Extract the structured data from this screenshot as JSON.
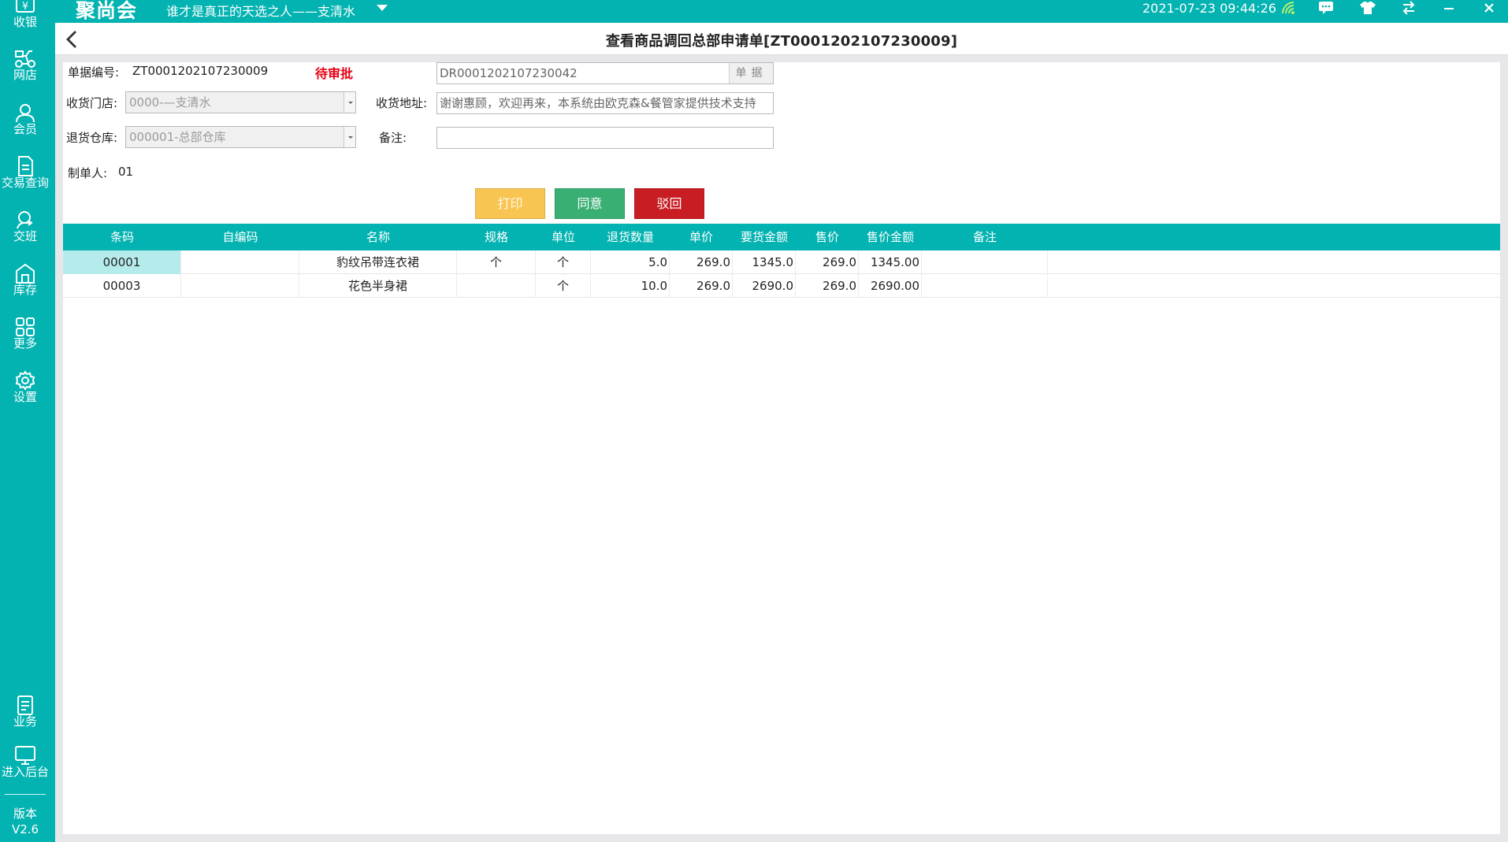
{
  "topbar": {
    "logo": "聚尚会",
    "store": "谁才是真正的天选之人——支清水",
    "datetime": "2021-07-23 09:44:26"
  },
  "sidebar": {
    "items": [
      {
        "label": "收银",
        "icon": "cashier-icon"
      },
      {
        "label": "网店",
        "icon": "delivery-icon"
      },
      {
        "label": "会员",
        "icon": "member-icon"
      },
      {
        "label": "交易查询",
        "icon": "document-icon"
      },
      {
        "label": "交班",
        "icon": "handover-icon"
      },
      {
        "label": "库存",
        "icon": "warehouse-icon"
      },
      {
        "label": "更多",
        "icon": "grid-icon"
      },
      {
        "label": "设置",
        "icon": "gear-icon"
      }
    ],
    "bottom_items": [
      {
        "label": "业务",
        "icon": "clipboard-icon"
      },
      {
        "label": "进入后台",
        "icon": "monitor-icon"
      }
    ],
    "version_label": "版本",
    "version": "V2.6"
  },
  "header": {
    "title": "查看商品调回总部申请单[ZT0001202107230009]"
  },
  "form": {
    "doc_no_label": "单据编号:",
    "doc_no": "ZT0001202107230009",
    "status": "待审批",
    "ref_doc": "DR0001202107230042",
    "ref_doc_button": "单据",
    "store_label": "收货门店:",
    "store_value": "0000-—支清水",
    "address_label": "收货地址:",
    "address_value": "谢谢惠顾，欢迎再来，本系统由欧克森&餐管家提供技术支持",
    "warehouse_label": "退货仓库:",
    "warehouse_value": "000001-总部仓库",
    "remark_label": "备注:",
    "remark_value": "",
    "creator_label": "制单人:",
    "creator": "01"
  },
  "actions": {
    "print": "打印",
    "approve": "同意",
    "reject": "驳回"
  },
  "colors": {
    "primary": "#02b3b1",
    "print": "#f8c552",
    "approve": "#3aaf74",
    "reject": "#c71d23",
    "status": "#e60012"
  },
  "table": {
    "columns": [
      "条码",
      "自编码",
      "名称",
      "规格",
      "单位",
      "退货数量",
      "单价",
      "要货金额",
      "售价",
      "售价金额",
      "备注"
    ],
    "rows": [
      {
        "barcode": "00001",
        "code": "",
        "name": "豹纹吊带连衣裙",
        "spec": "个",
        "unit": "个",
        "qty": "5.0",
        "price": "269.0",
        "amount": "1345.0",
        "sale_price": "269.0",
        "sale_amount": "1345.00",
        "remark": ""
      },
      {
        "barcode": "00003",
        "code": "",
        "name": "花色半身裙",
        "spec": "",
        "unit": "个",
        "qty": "10.0",
        "price": "269.0",
        "amount": "2690.0",
        "sale_price": "269.0",
        "sale_amount": "2690.00",
        "remark": ""
      }
    ]
  }
}
